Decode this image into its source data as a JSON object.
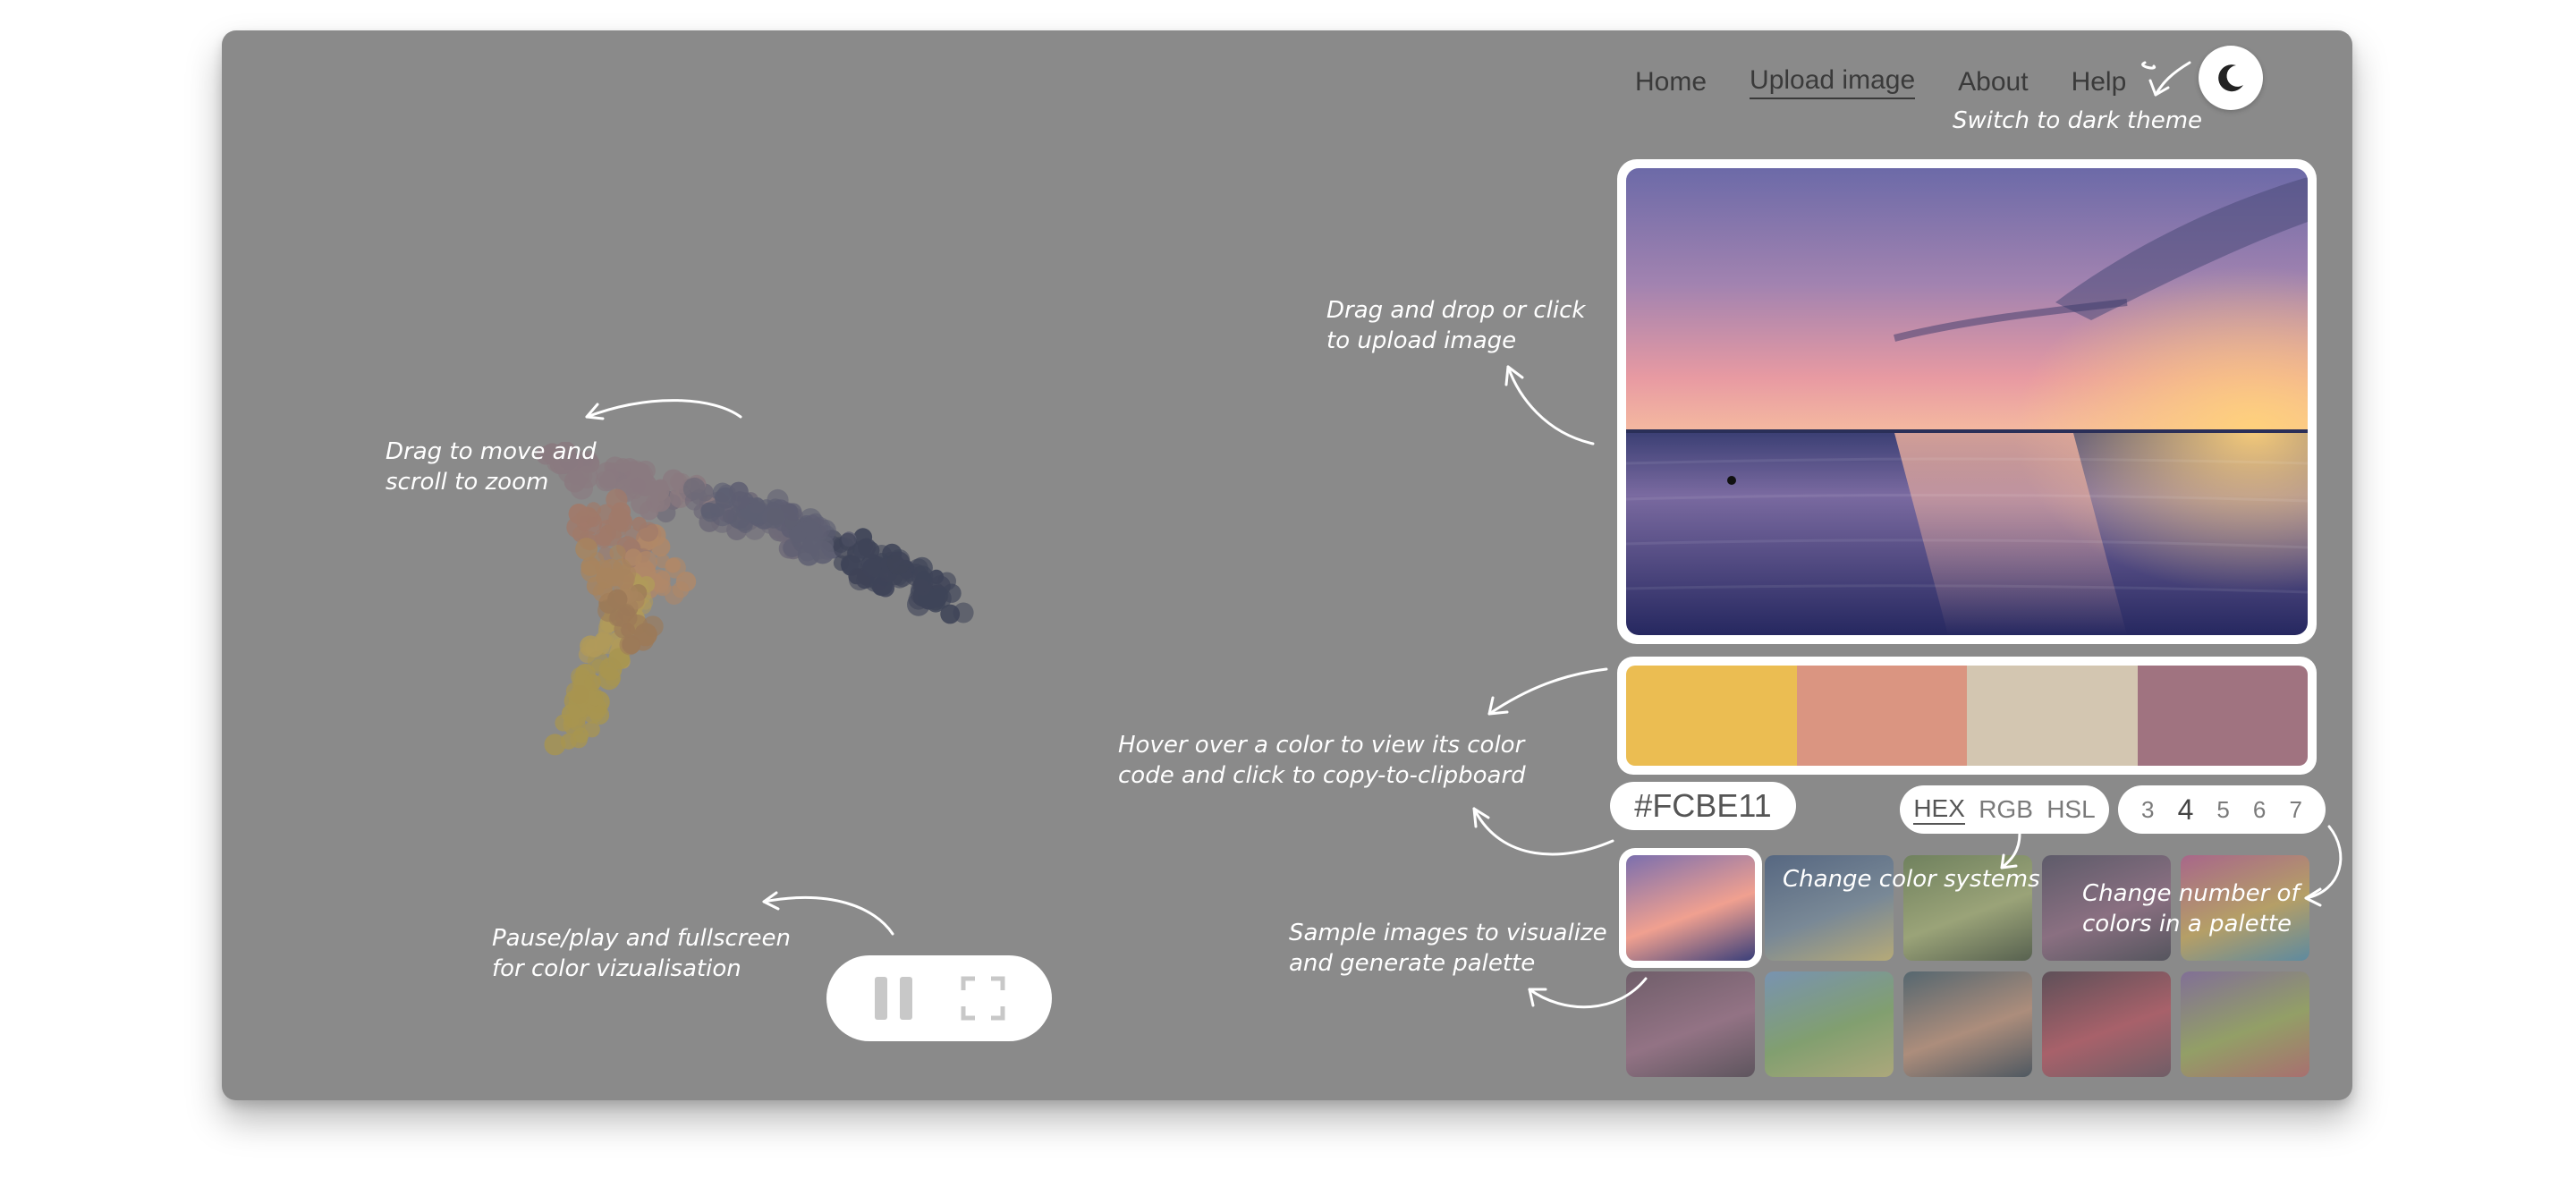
{
  "nav": {
    "items": [
      {
        "label": "Home",
        "active": false
      },
      {
        "label": "Upload image",
        "active": true
      },
      {
        "label": "About",
        "active": false
      },
      {
        "label": "Help",
        "active": false
      }
    ],
    "theme_icon": "moon-icon"
  },
  "annotations": {
    "theme": "Switch to dark theme",
    "upload": "Drag and drop or click\nto upload image",
    "cloud": "Drag to move and\nscroll to zoom",
    "hover": "Hover over a color to view its color\ncode and click to copy-to-clipboard",
    "systems": "Change color systems",
    "count": "Change number of\ncolors in a palette",
    "samples": "Sample images to visualize\nand generate palette",
    "playback": "Pause/play and fullscreen\nfor color vizualisation"
  },
  "palette": {
    "colors": [
      "#EBBD52",
      "#DA9581",
      "#D3C6B1",
      "#A07380"
    ]
  },
  "selected_color": {
    "code": "#FCBE11"
  },
  "color_systems": {
    "options": [
      "HEX",
      "RGB",
      "HSL"
    ],
    "selected": "HEX"
  },
  "color_counts": {
    "options": [
      "3",
      "4",
      "5",
      "6",
      "7"
    ],
    "selected": "4"
  },
  "samples": {
    "thumbnails": [
      {
        "name": "sunset-sea",
        "colors": [
          "#7b6fae",
          "#f0a090",
          "#3a3f7a"
        ]
      },
      {
        "name": "starry-night",
        "colors": [
          "#2c4b7a",
          "#6b87a0",
          "#d9c46a"
        ]
      },
      {
        "name": "green-leaves",
        "colors": [
          "#5a7a3a",
          "#a8b86a",
          "#2e4020"
        ]
      },
      {
        "name": "dark-abstract",
        "colors": [
          "#3a3550",
          "#8a5a7a",
          "#2a2a3a"
        ]
      },
      {
        "name": "color-streaks",
        "colors": [
          "#c04a8a",
          "#d8b04a",
          "#3a8ab0"
        ]
      },
      {
        "name": "pink-blossoms",
        "colors": [
          "#5a3a50",
          "#9a6080",
          "#3a2a3a"
        ]
      },
      {
        "name": "tree-field",
        "colors": [
          "#6a9ad0",
          "#7ab05a",
          "#c8c070"
        ]
      },
      {
        "name": "forest-lake",
        "colors": [
          "#2a4a5a",
          "#c89070",
          "#1e3040"
        ]
      },
      {
        "name": "city-night",
        "colors": [
          "#3a2030",
          "#c04050",
          "#5a3a4a"
        ]
      },
      {
        "name": "rainbow-blur",
        "colors": [
          "#7a5aa0",
          "#9ab04a",
          "#c05a5a"
        ]
      }
    ],
    "selected": 0
  },
  "playback": {
    "pause_icon": "pause-icon",
    "fullscreen_icon": "fullscreen-icon"
  }
}
